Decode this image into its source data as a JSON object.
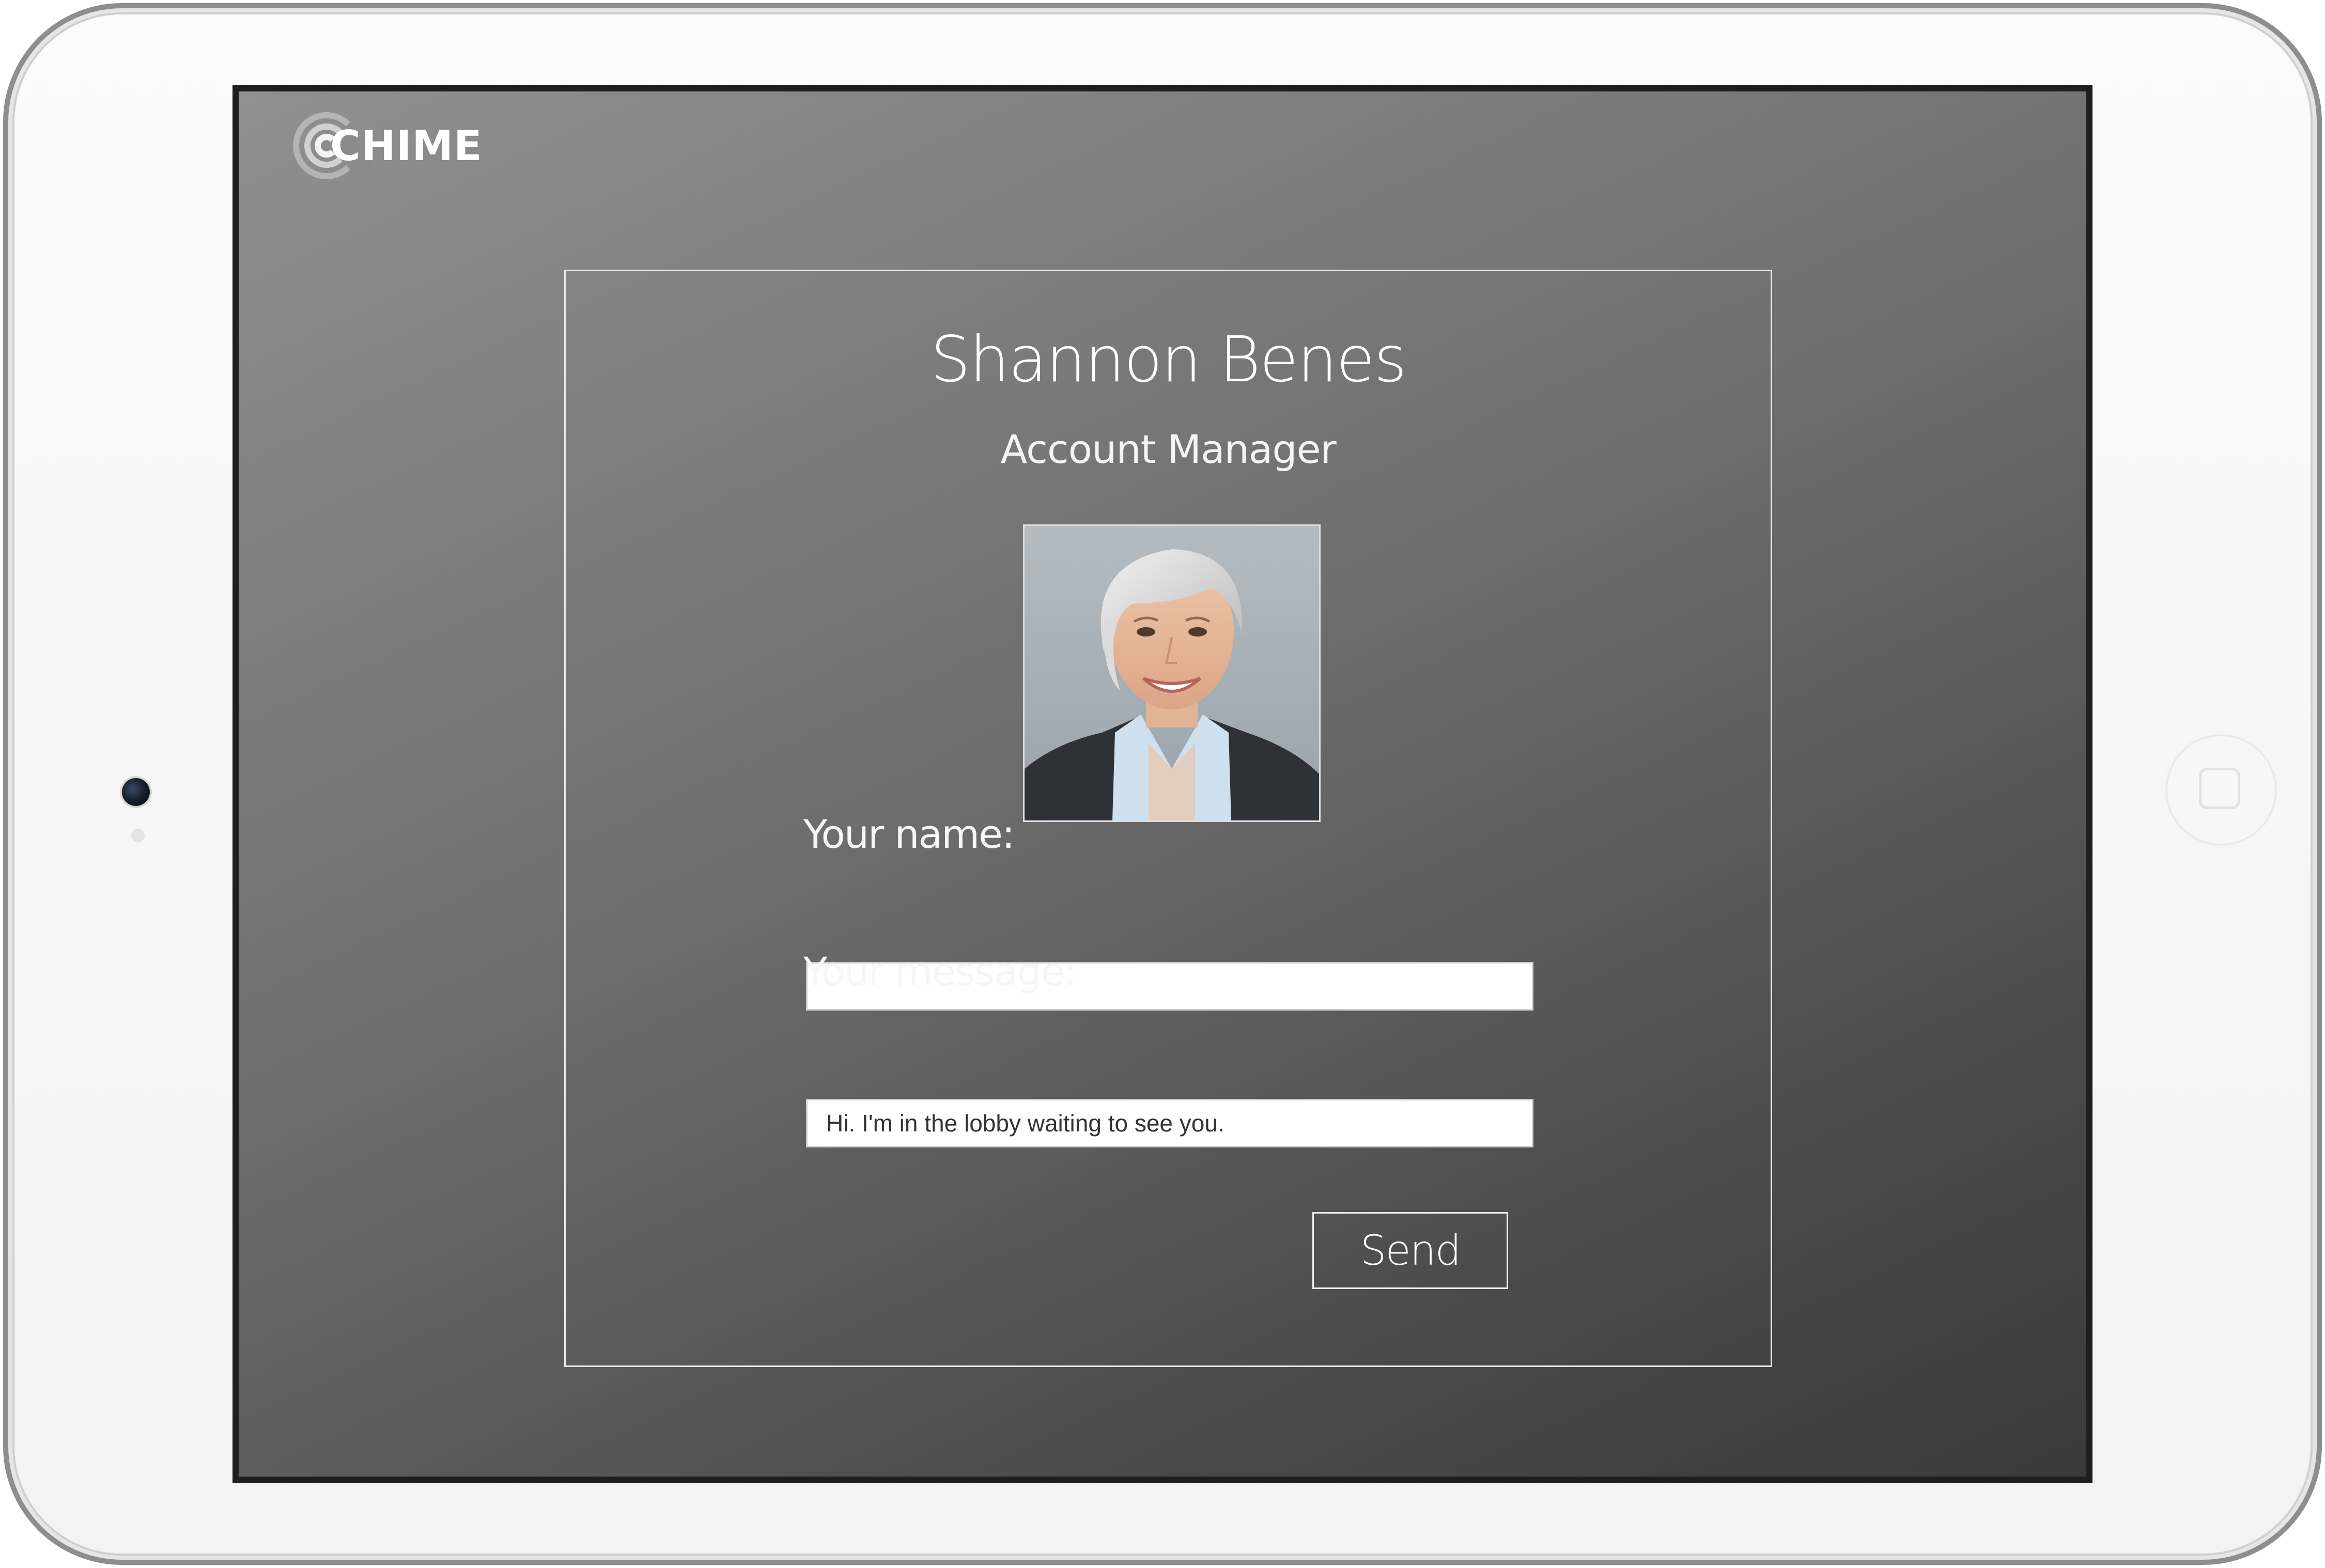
{
  "app": {
    "logo_text": "CHIME"
  },
  "contact": {
    "name": "Shannon Benes",
    "title": "Account Manager"
  },
  "form": {
    "name_label": "Your name:",
    "name_value": "",
    "message_label": "Your message:",
    "message_value": "Hi. I'm in the lobby waiting to see you.",
    "send_label": "Send"
  },
  "icons": {
    "logo": "chime-logo-icon",
    "camera": "front-camera",
    "home": "home-button"
  },
  "colors": {
    "screen_background_light": "#909090",
    "screen_background_dark": "#3a3a3a",
    "text": "#ffffff",
    "device_frame": "#f5f5f5"
  }
}
